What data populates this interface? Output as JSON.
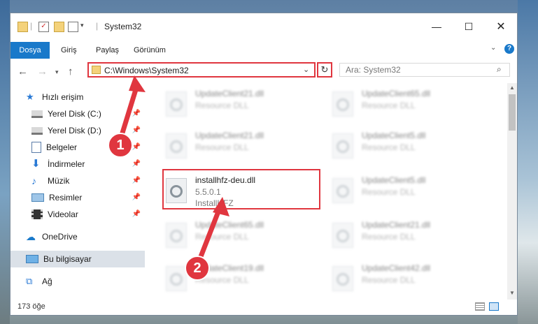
{
  "window": {
    "title": "System32"
  },
  "ribbon": {
    "tabs": [
      "Dosya",
      "Giriş",
      "Paylaş",
      "Görünüm"
    ]
  },
  "address": {
    "path": "C:\\Windows\\System32"
  },
  "search": {
    "placeholder": "Ara: System32"
  },
  "nav": {
    "quick_access": "Hızlı erişim",
    "items": [
      "Yerel Disk (C:)",
      "Yerel Disk (D:)",
      "Belgeler",
      "İndirmeler",
      "Müzik",
      "Resimler",
      "Videolar"
    ],
    "onedrive": "OneDrive",
    "this_pc": "Bu bilgisayar",
    "network": "Ağ"
  },
  "files": {
    "col1": [
      {
        "name": "UpdateClient21.dll",
        "desc": "Resource DLL"
      },
      {
        "name": "UpdateClient21.dll",
        "desc": "Resource DLL"
      },
      {
        "name": "installhfz-deu.dll",
        "version": "5.5.0.1",
        "desc": "InstallHFZ"
      },
      {
        "name": "UpdateClient65.dll",
        "desc": "Resource DLL"
      },
      {
        "name": "UpdateClient19.dll",
        "desc": "Resource DLL"
      }
    ],
    "col2": [
      {
        "name": "UpdateClient65.dll",
        "desc": "Resource DLL"
      },
      {
        "name": "UpdateClient5.dll",
        "desc": "Resource DLL"
      },
      {
        "name": "UpdateClient5.dll",
        "desc": "Resource DLL"
      },
      {
        "name": "UpdateClient21.dll",
        "desc": "Resource DLL"
      },
      {
        "name": "UpdateClient42.dll",
        "desc": "Resource DLL"
      }
    ]
  },
  "status": {
    "count": "173 öğe"
  },
  "callouts": [
    "1",
    "2"
  ],
  "colors": {
    "accent": "#1979ca",
    "highlight": "#e0363f"
  }
}
